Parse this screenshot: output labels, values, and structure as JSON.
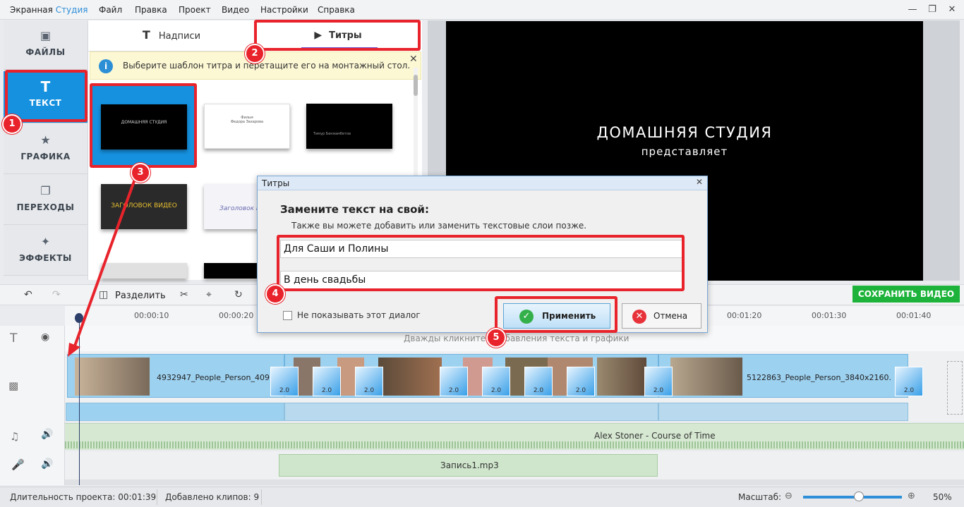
{
  "app": {
    "title_part1": "Экранная ",
    "title_part2": "Студия"
  },
  "menu": [
    "Файл",
    "Правка",
    "Проект",
    "Видео",
    "Настройки",
    "Справка"
  ],
  "sidebar": {
    "items": [
      {
        "label": "ФАЙЛЫ",
        "icon": "image-icon"
      },
      {
        "label": "ТЕКСТ",
        "icon": "text-icon"
      },
      {
        "label": "ГРАФИКА",
        "icon": "star-icon"
      },
      {
        "label": "ПЕРЕХОДЫ",
        "icon": "transitions-icon"
      },
      {
        "label": "ЭФФЕКТЫ",
        "icon": "magic-wand-icon"
      }
    ]
  },
  "panel": {
    "tabs": [
      {
        "label": "Надписи",
        "icon": "text-icon"
      },
      {
        "label": "Титры",
        "icon": "film-icon"
      }
    ],
    "info": "Выберите шаблон титра и перетащите его на монтажный стол.",
    "thumb_texts": {
      "t1": "ДОМАШНЯЯ СТУДИЯ",
      "t2": "ЗАГОЛОВОК ВИДЕО",
      "t3": "Фильм",
      "t4": "Федора Захарова",
      "t5": "Тимур Бекмамбетов",
      "t6": "Заголовок Видео"
    }
  },
  "preview": {
    "line1": "ДОМАШНЯЯ СТУДИЯ",
    "line2": "представляет"
  },
  "toolbar": {
    "split": "Разделить",
    "save": "СОХРАНИТЬ ВИДЕО"
  },
  "timeline": {
    "ticks": [
      "00:00:10",
      "00:00:20",
      "00:01:20",
      "00:01:30",
      "00:01:40"
    ],
    "text_hint": "Дважды кликните д... бавления текста и графики",
    "clip1": "4932947_People_Person_409",
    "clip2": "5122863_People_Person_3840x2160.",
    "transition_duration": "2.0",
    "music": "Alex Stoner - Course of Time",
    "voice": "Запись1.mp3"
  },
  "status": {
    "duration_label": "Длительность проекта:",
    "duration": "00:01:39",
    "clips_label": "Добавлено клипов:",
    "clips": "9",
    "zoom_label": "Масштаб:",
    "zoom": "50%",
    "zoom_level": 0.55
  },
  "dialog": {
    "title": "Титры",
    "heading": "Замените текст на свой:",
    "subtext": "Также вы можете добавить или заменить текстовые слои позже.",
    "field1": "Для Саши и Полины",
    "field2": "В день свадьбы",
    "dont_show": "Не показывать этот диалог",
    "apply": "Применить",
    "cancel": "Отмена"
  },
  "annotations": [
    "1",
    "2",
    "3",
    "4",
    "5"
  ],
  "colors": {
    "accent": "#1591df",
    "annotation": "#e8232b",
    "save": "#1db33a"
  }
}
